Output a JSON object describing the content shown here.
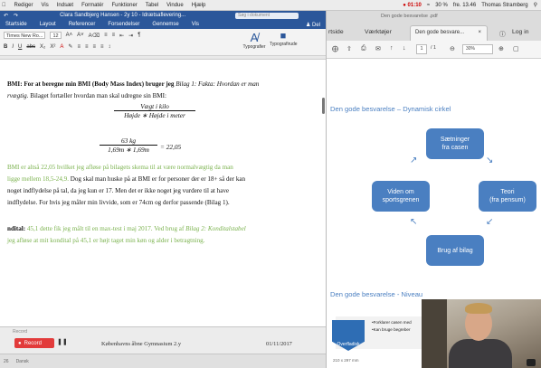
{
  "menubar": {
    "items": [
      "",
      "Rediger",
      "Vis",
      "Indsæt",
      "Formatér",
      "Funktioner",
      "Tabel",
      "Vindue",
      "Hjælp"
    ],
    "rec_time": "01:10",
    "battery": "30 %",
    "clock": "fre. 13.46",
    "user": "Thomas Stramberg"
  },
  "word": {
    "title_doc": "Clara Sandbjerg Hansen - 2y 10 - Idrætsaflevering...",
    "search_placeholder": "Søg i dokument",
    "tabs": [
      "Startside",
      "Layout",
      "Referencer",
      "Forsendelser",
      "Gennemse",
      "Vis"
    ],
    "share_label": "Del",
    "font_name": "Times New Ro...",
    "font_size": "12",
    "styles_label": "Typografier",
    "style_pane_label": "Typografirude",
    "doc": {
      "line1_prefix": "BMI: For at beregne min BMI (Body Mass Index) bruger jeg ",
      "line1_italic": "Bilag 1: Fakta: Hvordan er man",
      "line2_italic": "rvægtig.",
      "line2_rest": " Bilaget fortæller hvordan man skal udregne sin BMI:",
      "formula1_num": "Vægt i kilo",
      "formula1_den": "Højde ∗ Højde i meter",
      "formula2_num": "63 kg",
      "formula2_den": "1,69m ∗ 1,69m",
      "formula2_result": "= 22,05",
      "line3_green": "BMI er altså 22,05 hvilket jeg afløse på bilagets skema til at være normalvægtig da man",
      "line4_green": "ligge mellem 18,5-24,9.",
      "line4_rest": " Dog skal man huske på at BMI er for personer der er 18+ så der kan",
      "line5": "noget indflydelse på tal, da jeg kun er 17. Men det er ikke noget jeg vurdere til at have",
      "line6": "indflydelse. For hvis jeg måler min livvide, som er 74cm og derfor passende (Bilag 1).",
      "line7_bold": "ndital:",
      "line7_green": " 45,1 dette fik jeg målt til en max-test i maj 2017. Ved brug af ",
      "line7_italic": "Bilag 2: Konditalstabel",
      "line8_green": "jeg afløse at mit kondital på 45,1 er højt taget min køn og alder i betragtning."
    },
    "record_label": "Record",
    "record_button": "Record",
    "footer_school": "Københavns åbne Gymnasium 2.y",
    "footer_date": "01/11/2017",
    "status_page": "26",
    "status_lang": "Dansk"
  },
  "pdf": {
    "window_title": "Den gode besvarelse .pdf",
    "tab_home": "rtside",
    "tab_tools": "Værktøjer",
    "tab_doc": "Den gode besvare...",
    "login": "Log in",
    "page_current": "1",
    "page_total": "/ 1",
    "zoom": "30%",
    "slide1_title": "Den gode besvarelse – Dynamisk cirkel",
    "cycle_top": "Sætninger\nfra casen",
    "cycle_right": "Teori\n(fra pensum)",
    "cycle_bottom": "Brug af bilag",
    "cycle_left": "Viden om\nsportsgrenen",
    "slide2_title": "Den gode besvarelse - Niveau",
    "niveau_label": "Overfladisk",
    "niveau_items": [
      "•Forklarer casen med",
      "•Kan bruge begreber"
    ],
    "slide_size": "210 x 297 mm"
  }
}
